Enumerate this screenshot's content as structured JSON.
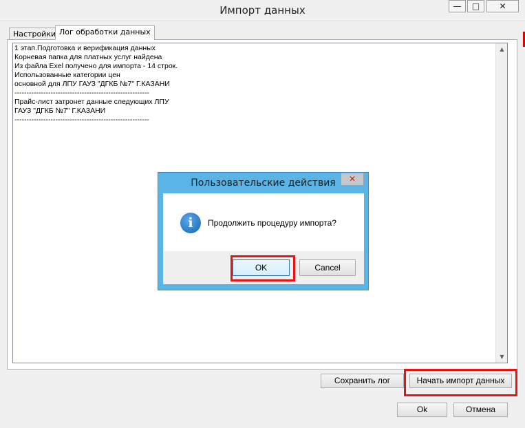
{
  "window": {
    "title": "Импорт данных",
    "minimize_glyph": "—",
    "maximize_glyph": "□",
    "close_glyph": "✕"
  },
  "tabs": [
    {
      "label": "Настройки",
      "active": false
    },
    {
      "label": "Лог обработки данных",
      "active": true
    }
  ],
  "log": {
    "text": "1 этап.Подготовка и верификация данных\nКорневая папка для платных услуг найдена\nИз файла Exel получено для импорта - 14 строк.\nИспользованные категории цен\nосновной для ЛПУ ГАУЗ \"ДГКБ №7\" Г.КАЗАНИ\n--------------------------------------------------------\nПрайс-лист затронет данные следующих ЛПУ\nГАУЗ \"ДГКБ №7\" Г.КАЗАНИ\n--------------------------------------------------------"
  },
  "buttons": {
    "save_log": "Сохранить лог",
    "start_import": "Начать импорт данных",
    "ok": "Ok",
    "cancel": "Отмена"
  },
  "dialog": {
    "title": "Пользовательские действия",
    "close_glyph": "✕",
    "icon": "info-icon",
    "icon_glyph": "i",
    "message": "Продолжить процедуру импорта?",
    "ok_label": "OK",
    "cancel_label": "Cancel"
  },
  "colors": {
    "dialog_frame": "#5ab4e5",
    "highlight": "#ee1111"
  }
}
